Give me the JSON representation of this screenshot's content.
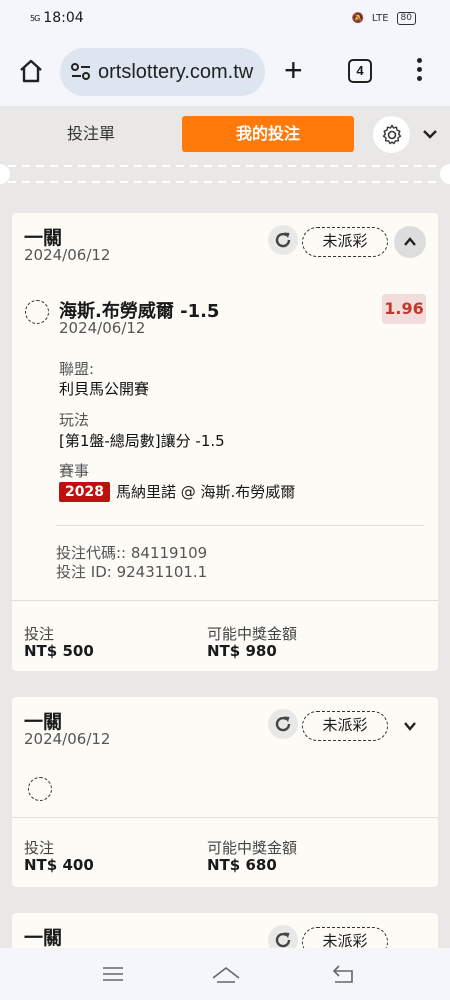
{
  "status_bar": {
    "time": "18:04",
    "signal": "5G",
    "battery": "80"
  },
  "browser": {
    "url": "ortslottery.com.tw",
    "tab_count": "4"
  },
  "topnav": {
    "betslip": "投注單",
    "mybets": "我的投注"
  },
  "cards": [
    {
      "title": "一關",
      "date": "2024/06/12",
      "status": "未派彩",
      "selection": "海斯.布勞威爾 -1.5",
      "odds": "1.96",
      "selection_date": "2024/06/12",
      "league_label": "聯盟:",
      "league": "利貝馬公開賽",
      "market_label": "玩法",
      "market": "[第1盤-總局數]讓分 -1.5",
      "event_label": "賽事",
      "event_id": "2028",
      "event": "馬納里諾 @ 海斯.布勞威爾",
      "bet_code": "投注代碼:: 84119109",
      "bet_id": "投注 ID: 92431101.1",
      "stake_label": "投注",
      "stake": "NT$ 500",
      "win_label": "可能中獎金額",
      "win": "NT$ 980"
    },
    {
      "title": "一關",
      "date": "2024/06/12",
      "status": "未派彩",
      "stake_label": "投注",
      "stake": "NT$ 400",
      "win_label": "可能中獎金額",
      "win": "NT$ 680"
    },
    {
      "title": "一關",
      "status": "未派彩"
    }
  ]
}
